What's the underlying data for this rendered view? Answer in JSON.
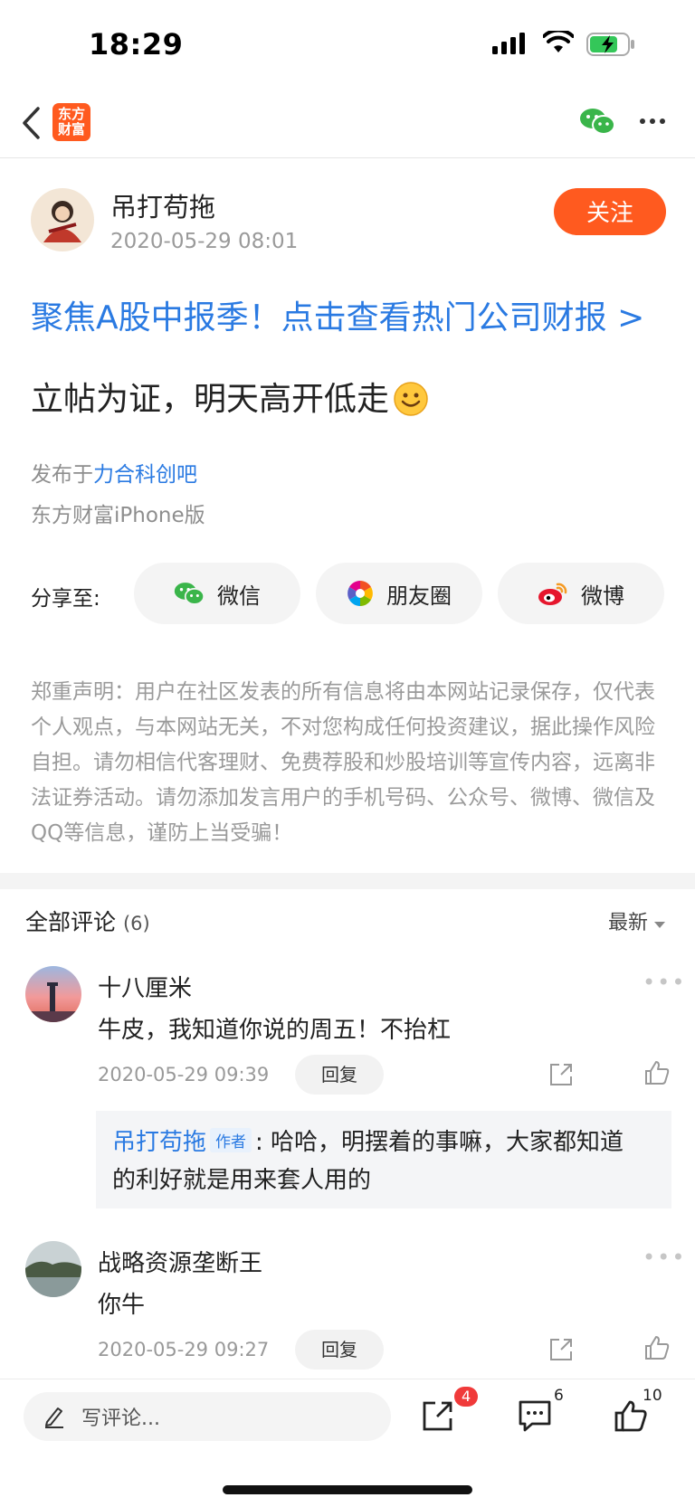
{
  "status_bar": {
    "time": "18:29"
  },
  "nav": {
    "logo_text": "东方财富"
  },
  "post": {
    "author": "吊打苟拖",
    "time": "2020-05-29 08:01",
    "follow_label": "关注",
    "banner": "聚焦A股中报季！点击查看热门公司财报 >",
    "content": "立帖为证，明天高开低走",
    "published_prefix": "发布于",
    "forum": "力合科创吧",
    "device": "东方财富iPhone版"
  },
  "share": {
    "label": "分享至:",
    "buttons": [
      "微信",
      "朋友圈",
      "微博"
    ]
  },
  "disclaimer": "郑重声明：用户在社区发表的所有信息将由本网站记录保存，仅代表个人观点，与本网站无关，不对您构成任何投资建议，据此操作风险自担。请勿相信代客理财、免费荐股和炒股培训等宣传内容，远离非法证券活动。请勿添加发言用户的手机号码、公众号、微博、微信及QQ等信息，谨防上当受骗！",
  "comments_header": {
    "title": "全部评论",
    "count": "(6)",
    "sort": "最新"
  },
  "comments": [
    {
      "name": "十八厘米",
      "text": "牛皮，我知道你说的周五！不抬杠",
      "date": "2020-05-29 09:39",
      "reply_label": "回复",
      "sub_reply": {
        "name": "吊打苟拖",
        "tag": "作者",
        "sep": ":",
        "text_line1": "哈哈，明摆着的事嘛，大家都知道",
        "text_line2": "的利好就是用来套人用的"
      }
    },
    {
      "name": "战略资源垄断王",
      "text": "你牛",
      "date": "2020-05-29 09:27",
      "reply_label": "回复"
    }
  ],
  "bottom_bar": {
    "write_placeholder": "写评论...",
    "share_badge": "4",
    "comment_count": "6",
    "like_count": "10"
  },
  "colors": {
    "accent": "#ff5a1f",
    "link": "#2a7ae2"
  }
}
